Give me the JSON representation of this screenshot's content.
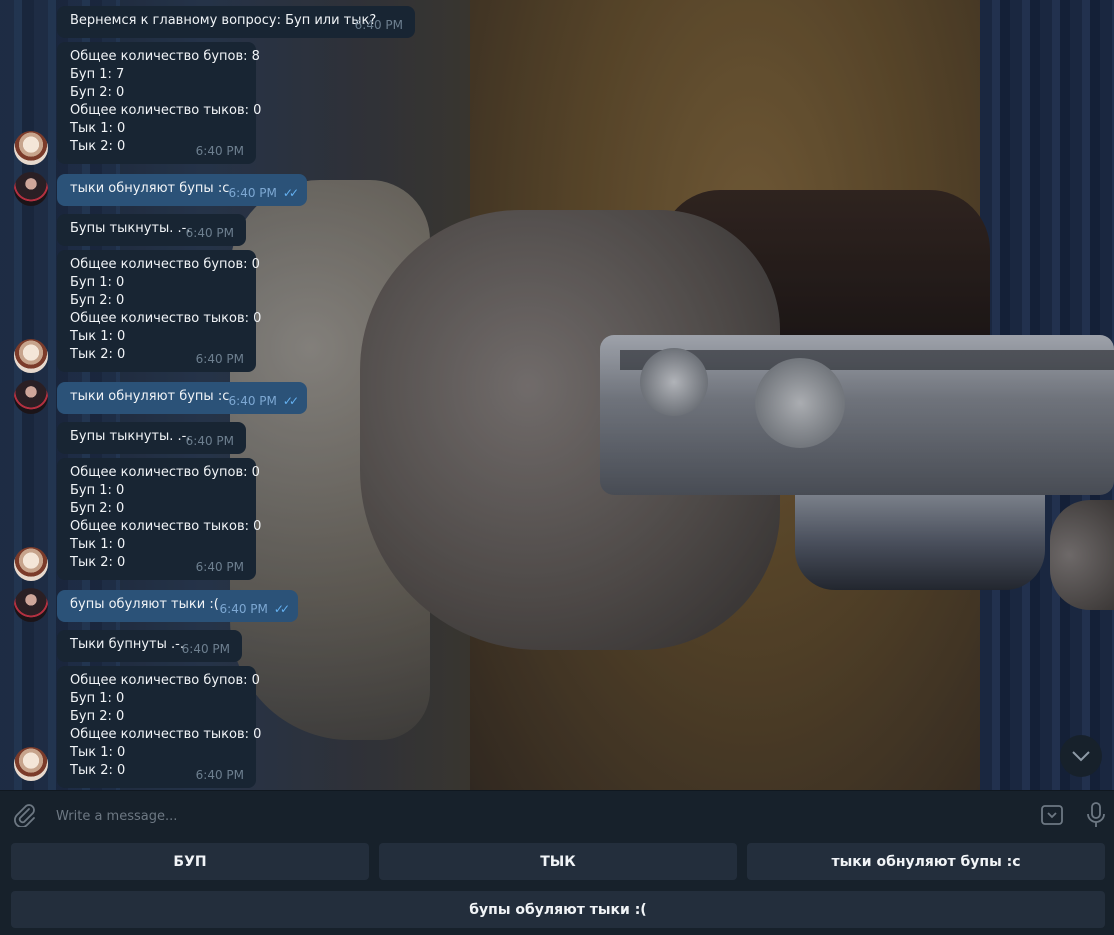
{
  "messages": [
    {
      "type": "bot",
      "lines": [
        "Вернемся к главному вопросу: Буп или тык?"
      ],
      "time": "6:40 PM"
    },
    {
      "type": "bot",
      "lines": [
        "Общее количество бупов: 8",
        "Буп 1: 7",
        "Буп 2: 0",
        "Общее количество тыков: 0",
        "Тык 1: 0",
        "Тык 2: 0"
      ],
      "time": "6:40 PM"
    },
    {
      "type": "out",
      "lines": [
        "тыки обнуляют бупы :с"
      ],
      "time": "6:40 PM"
    },
    {
      "type": "bot",
      "lines": [
        "Бупы тыкнуты. .-."
      ],
      "time": "6:40 PM"
    },
    {
      "type": "bot",
      "lines": [
        "Общее количество бупов: 0",
        "Буп 1: 0",
        "Буп 2: 0",
        "Общее количество тыков: 0",
        "Тык 1: 0",
        "Тык 2: 0"
      ],
      "time": "6:40 PM"
    },
    {
      "type": "out",
      "lines": [
        "тыки обнуляют бупы :с"
      ],
      "time": "6:40 PM"
    },
    {
      "type": "bot",
      "lines": [
        "Бупы тыкнуты. .-."
      ],
      "time": "6:40 PM"
    },
    {
      "type": "bot",
      "lines": [
        "Общее количество бупов: 0",
        "Буп 1: 0",
        "Буп 2: 0",
        "Общее количество тыков: 0",
        "Тык 1: 0",
        "Тык 2: 0"
      ],
      "time": "6:40 PM"
    },
    {
      "type": "out",
      "lines": [
        "бупы обуляют тыки :("
      ],
      "time": "6:40 PM"
    },
    {
      "type": "bot",
      "lines": [
        "Тыки бупнуты .-."
      ],
      "time": "6:40 PM"
    },
    {
      "type": "bot",
      "lines": [
        "Общее количество бупов: 0",
        "Буп 1: 0",
        "Буп 2: 0",
        "Общее количество тыков: 0",
        "Тык 1: 0",
        "Тык 2: 0"
      ],
      "time": "6:40 PM"
    }
  ],
  "composer": {
    "placeholder": "Write a message...",
    "attach_icon": "paperclip-icon",
    "keyboard_icon": "bot-keyboard-icon",
    "mic_icon": "microphone-icon"
  },
  "keyboard": {
    "row1": [
      "БУП",
      "ТЫК",
      "тыки обнуляют бупы :с"
    ],
    "row2": [
      "бупы обуляют тыки :("
    ]
  },
  "colors": {
    "incoming_bubble": "#182533",
    "outgoing_bubble": "#2b5278",
    "panel": "#17212b",
    "keyboard_button": "#232e3c",
    "read_ticks": "#64b0f0"
  }
}
